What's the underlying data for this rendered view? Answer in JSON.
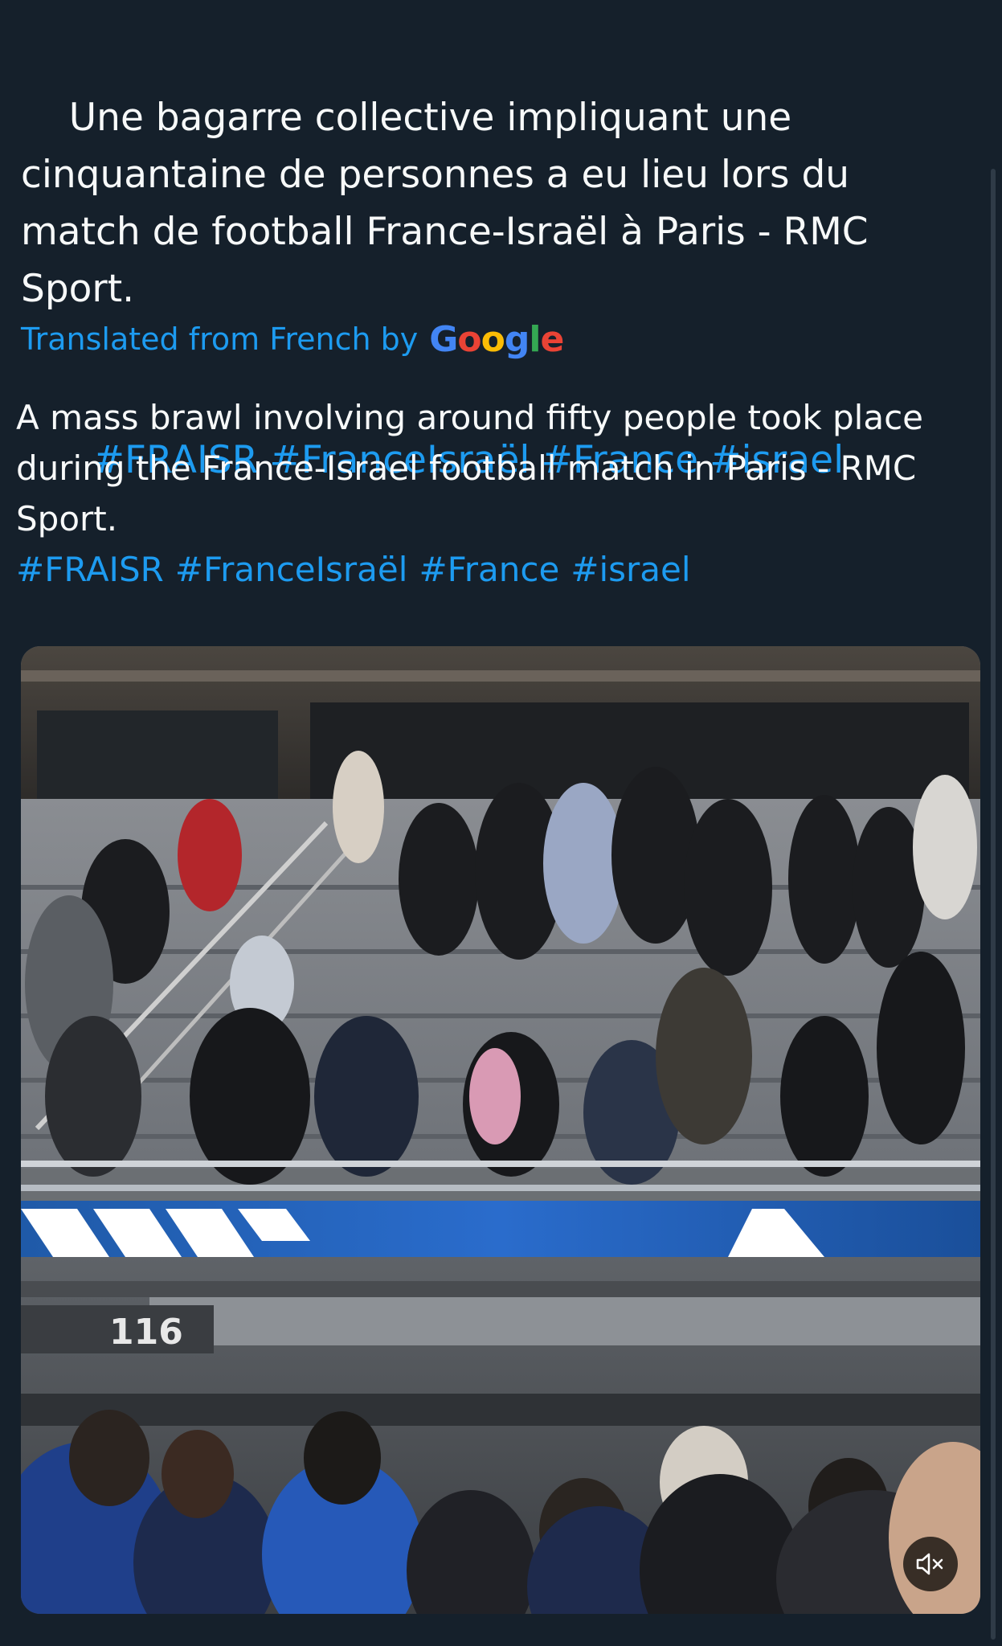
{
  "tweet": {
    "original_text": "Une bagarre collective impliquant une cinquantaine de personnes a eu lieu lors du match de football France-Israël à Paris - RMC Sport.",
    "hashtags": [
      "#FRAISR",
      "#FranceIsraël",
      "#France",
      "#israel"
    ],
    "translation_label": "Translated from French by",
    "translation_provider": "Google",
    "translated_text": "A mass brawl involving around fifty people took place during the France-Israel football match in Paris - RMC Sport.",
    "translated_hashtags": [
      "#FRAISR",
      "#FranceIsraël",
      "#France",
      "#israel"
    ]
  },
  "media": {
    "section_number": "116",
    "mute_icon": "volume-muted-icon"
  },
  "colors": {
    "background": "#15202b",
    "text": "#f7f9f9",
    "link": "#1d9bf0"
  }
}
